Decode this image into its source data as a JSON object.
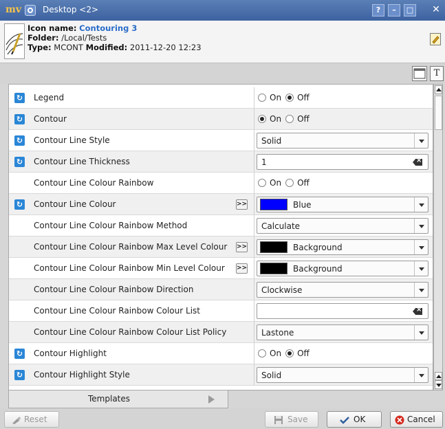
{
  "window": {
    "logo_text": "mv",
    "title": "Desktop <2>",
    "help_label": "?",
    "minimize_label": "–",
    "close_label": "✕"
  },
  "info": {
    "icon_name_label": "Icon name:",
    "icon_name": "Contouring 3",
    "folder_label": "Folder:",
    "folder": "/Local/Tests",
    "type_label": "Type:",
    "type": "MCONT",
    "modified_label": "Modified:",
    "modified": "2011-12-20 12:23"
  },
  "subbar": {
    "text_icon_label": "T"
  },
  "options": {
    "on": "On",
    "off": "Off"
  },
  "rows": [
    {
      "label": "Legend",
      "reset": true,
      "widget": "radio",
      "value": "Off"
    },
    {
      "label": "Contour",
      "reset": true,
      "widget": "radio",
      "value": "On"
    },
    {
      "label": "Contour Line Style",
      "reset": true,
      "widget": "combo",
      "value": "Solid"
    },
    {
      "label": "Contour Line Thickness",
      "reset": true,
      "widget": "text",
      "value": "1"
    },
    {
      "label": "Contour Line Colour Rainbow",
      "reset": false,
      "widget": "radio",
      "value": ""
    },
    {
      "label": "Contour Line Colour",
      "reset": true,
      "widget": "color",
      "value": "Blue",
      "swatch": "#0000ff",
      "more": true
    },
    {
      "label": "Contour Line Colour Rainbow Method",
      "reset": false,
      "widget": "combo",
      "value": "Calculate"
    },
    {
      "label": "Contour Line Colour Rainbow Max Level Colour",
      "reset": false,
      "widget": "color",
      "value": "Background",
      "swatch": "#000000",
      "more": true
    },
    {
      "label": "Contour Line Colour Rainbow Min Level Colour",
      "reset": false,
      "widget": "color",
      "value": "Background",
      "swatch": "#000000",
      "more": true
    },
    {
      "label": "Contour Line Colour Rainbow Direction",
      "reset": false,
      "widget": "combo",
      "value": "Clockwise"
    },
    {
      "label": "Contour Line Colour Rainbow Colour List",
      "reset": false,
      "widget": "text",
      "value": ""
    },
    {
      "label": "Contour Line Colour Rainbow Colour List Policy",
      "reset": false,
      "widget": "combo",
      "value": "Lastone"
    },
    {
      "label": "Contour Highlight",
      "reset": true,
      "widget": "radio",
      "value": "Off"
    },
    {
      "label": "Contour Highlight Style",
      "reset": true,
      "widget": "combo",
      "value": "Solid"
    }
  ],
  "tabs": {
    "templates": "Templates"
  },
  "buttons": {
    "reset": "Reset",
    "save": "Save",
    "ok": "OK",
    "cancel": "Cancel"
  },
  "colors": {
    "titlebar": "#3d62a0",
    "accent_blue": "#2a86d6",
    "icon_name": "#2a6cc9",
    "cancel_red": "#d42a1e"
  }
}
